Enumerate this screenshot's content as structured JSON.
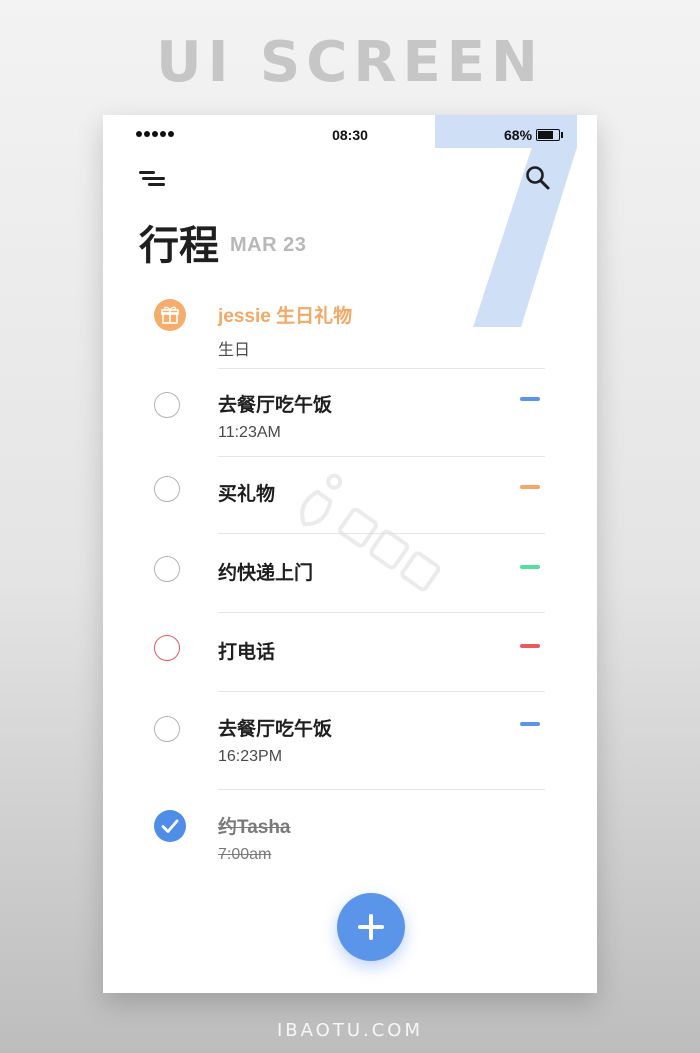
{
  "banner": {
    "top": "UI SCREEN",
    "bottom": "IBAOTU.COM"
  },
  "decor": {
    "big_number": "7",
    "big_number_color": "#cfdff6"
  },
  "status_bar": {
    "signal": "●●●●●",
    "time": "08:30",
    "battery": "68%",
    "battery_level": 0.68
  },
  "header": {
    "title": "行程",
    "date": "MAR 23",
    "menu_icon": "menu-icon",
    "search_icon": "search-icon"
  },
  "tasks": [
    {
      "title": "jessie 生日礼物",
      "subtitle": "生日",
      "state": "gift",
      "icon": "gift-icon",
      "tag_color": ""
    },
    {
      "title": "去餐厅吃午饭",
      "subtitle": "11:23AM",
      "state": "open",
      "tag_color": "#5b95ea"
    },
    {
      "title": "买礼物",
      "subtitle": "",
      "state": "open",
      "tag_color": "#f3a865"
    },
    {
      "title": "约快递上门",
      "subtitle": "",
      "state": "open",
      "tag_color": "#55e0a0"
    },
    {
      "title": "打电话",
      "subtitle": "",
      "state": "urgent",
      "tag_color": "#ea5a5a"
    },
    {
      "title": "去餐厅吃午饭",
      "subtitle": "16:23PM",
      "state": "open",
      "tag_color": "#5b95ea"
    },
    {
      "title": "约Tasha",
      "subtitle": "7:00am",
      "state": "done",
      "icon": "check-icon",
      "tag_color": ""
    }
  ],
  "fab": {
    "icon": "plus-icon",
    "color": "#5b95ea"
  },
  "colors": {
    "accent": "#5b95ea",
    "orange": "#f3a865",
    "red": "#ea5a5a",
    "green": "#55e0a0"
  }
}
